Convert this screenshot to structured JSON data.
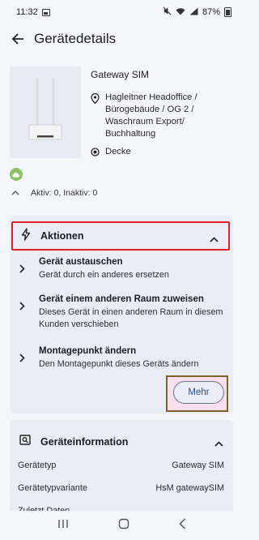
{
  "status": {
    "time": "11:32",
    "battery": "87%"
  },
  "appbar": {
    "title": "Gerätedetails"
  },
  "device": {
    "name": "Gateway SIM",
    "location": "Hagleitner Headoffice / Bürogebäude / OG 2 / Waschraum Export/ Buchhaltung",
    "mount": "Decke"
  },
  "stats": {
    "text": "Aktiv: 0, Inaktiv: 0"
  },
  "actions": {
    "title": "Aktionen",
    "items": [
      {
        "title": "Gerät austauschen",
        "desc": "Gerät durch ein anderes ersetzen"
      },
      {
        "title": "Gerät einem anderen Raum zuweisen",
        "desc": "Dieses Gerät in einen anderen Raum in diesem Kunden verschieben"
      },
      {
        "title": "Montagepunkt ändern",
        "desc": "Den Montagepunkt dieses Geräts ändern"
      }
    ],
    "more_label": "Mehr"
  },
  "info": {
    "title": "Geräteinformation",
    "rows": [
      {
        "label": "Gerätetyp",
        "value": "Gateway SIM"
      },
      {
        "label": "Gerätetypvariante",
        "value": "HsM gatewaySIM"
      },
      {
        "label": "Zuletzt Daten",
        "value": ""
      }
    ]
  },
  "colors": {
    "highlight_red": "#e0202a",
    "highlight_olive": "#7a6328",
    "highlight_pink": "#f8dff0",
    "card_bg": "#eaedf6",
    "link_blue": "#2b4d8f",
    "cloud_green": "#8dc16a"
  },
  "icons": {
    "back": "arrow-left-icon",
    "location": "map-pin-icon",
    "mount": "target-icon",
    "cloud": "cloud-icon",
    "actions": "lightning-icon",
    "chevron": "chevron-up-icon",
    "item_arrow": "chevron-right-icon",
    "info": "search-card-icon"
  }
}
